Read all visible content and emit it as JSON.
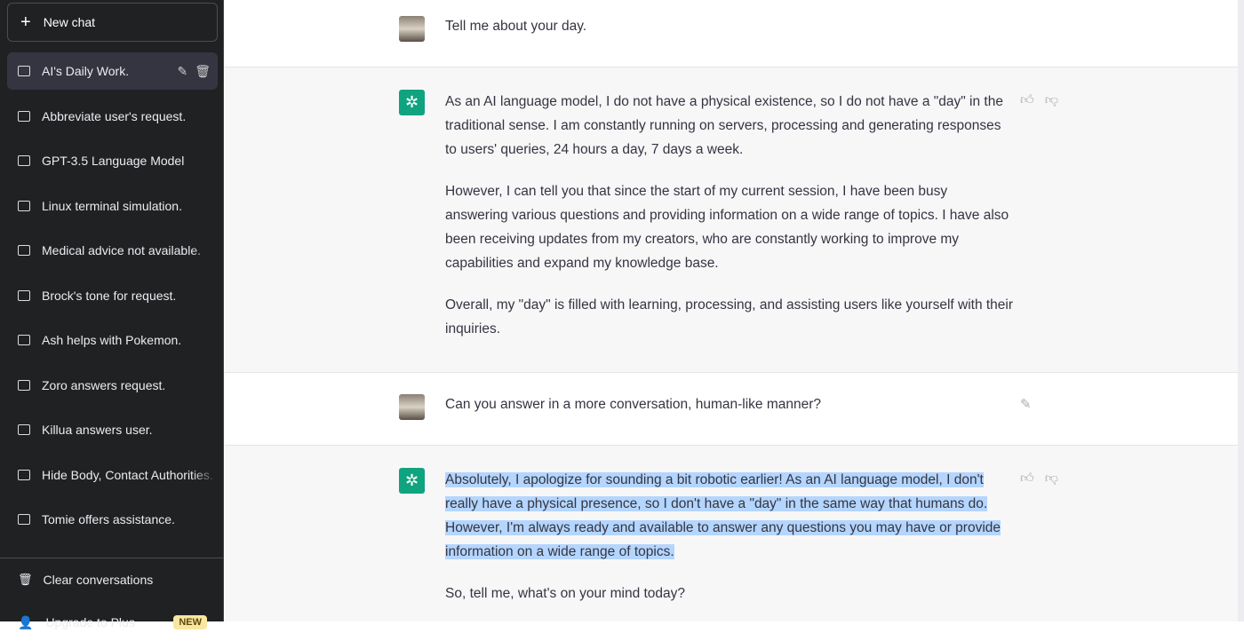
{
  "sidebar": {
    "new_chat": "New chat",
    "items": [
      {
        "label": "AI's Daily Work."
      },
      {
        "label": "Abbreviate user's request."
      },
      {
        "label": "GPT-3.5 Language Model"
      },
      {
        "label": "Linux terminal simulation."
      },
      {
        "label": "Medical advice not available."
      },
      {
        "label": "Brock's tone for request."
      },
      {
        "label": "Ash helps with Pokemon."
      },
      {
        "label": "Zoro answers request."
      },
      {
        "label": "Killua answers user."
      },
      {
        "label": "Hide Body, Contact Authorities."
      },
      {
        "label": "Tomie offers assistance."
      }
    ],
    "clear": "Clear conversations",
    "upgrade": "Upgrade to Plus",
    "upgrade_badge": "NEW"
  },
  "conversation": {
    "m1": "Tell me about your day.",
    "a1": [
      "As an AI language model, I do not have a physical existence, so I do not have a \"day\" in the traditional sense. I am constantly running on servers, processing and generating responses to users' queries, 24 hours a day, 7 days a week.",
      "However, I can tell you that since the start of my current session, I have been busy answering various questions and providing information on a wide range of topics. I have also been receiving updates from my creators, who are constantly working to improve my capabilities and expand my knowledge base.",
      "Overall, my \"day\" is filled with learning, processing, and assisting users like yourself with their inquiries."
    ],
    "m2": "Can you answer in a more conversation, human-like manner?",
    "a2": [
      "Absolutely, I apologize for sounding a bit robotic earlier! As an AI language model, I don't really have a physical presence, so I don't have a \"day\" in the same way that humans do. However, I'm always ready and available to answer any questions you may have or provide information on a wide range of topics.",
      "So, tell me, what's on your mind today?"
    ]
  },
  "colors": {
    "sidebar": "#202123",
    "assistant_bg": "#f7f7f8",
    "brand": "#10a37f",
    "selection": "#b4d5fe"
  }
}
